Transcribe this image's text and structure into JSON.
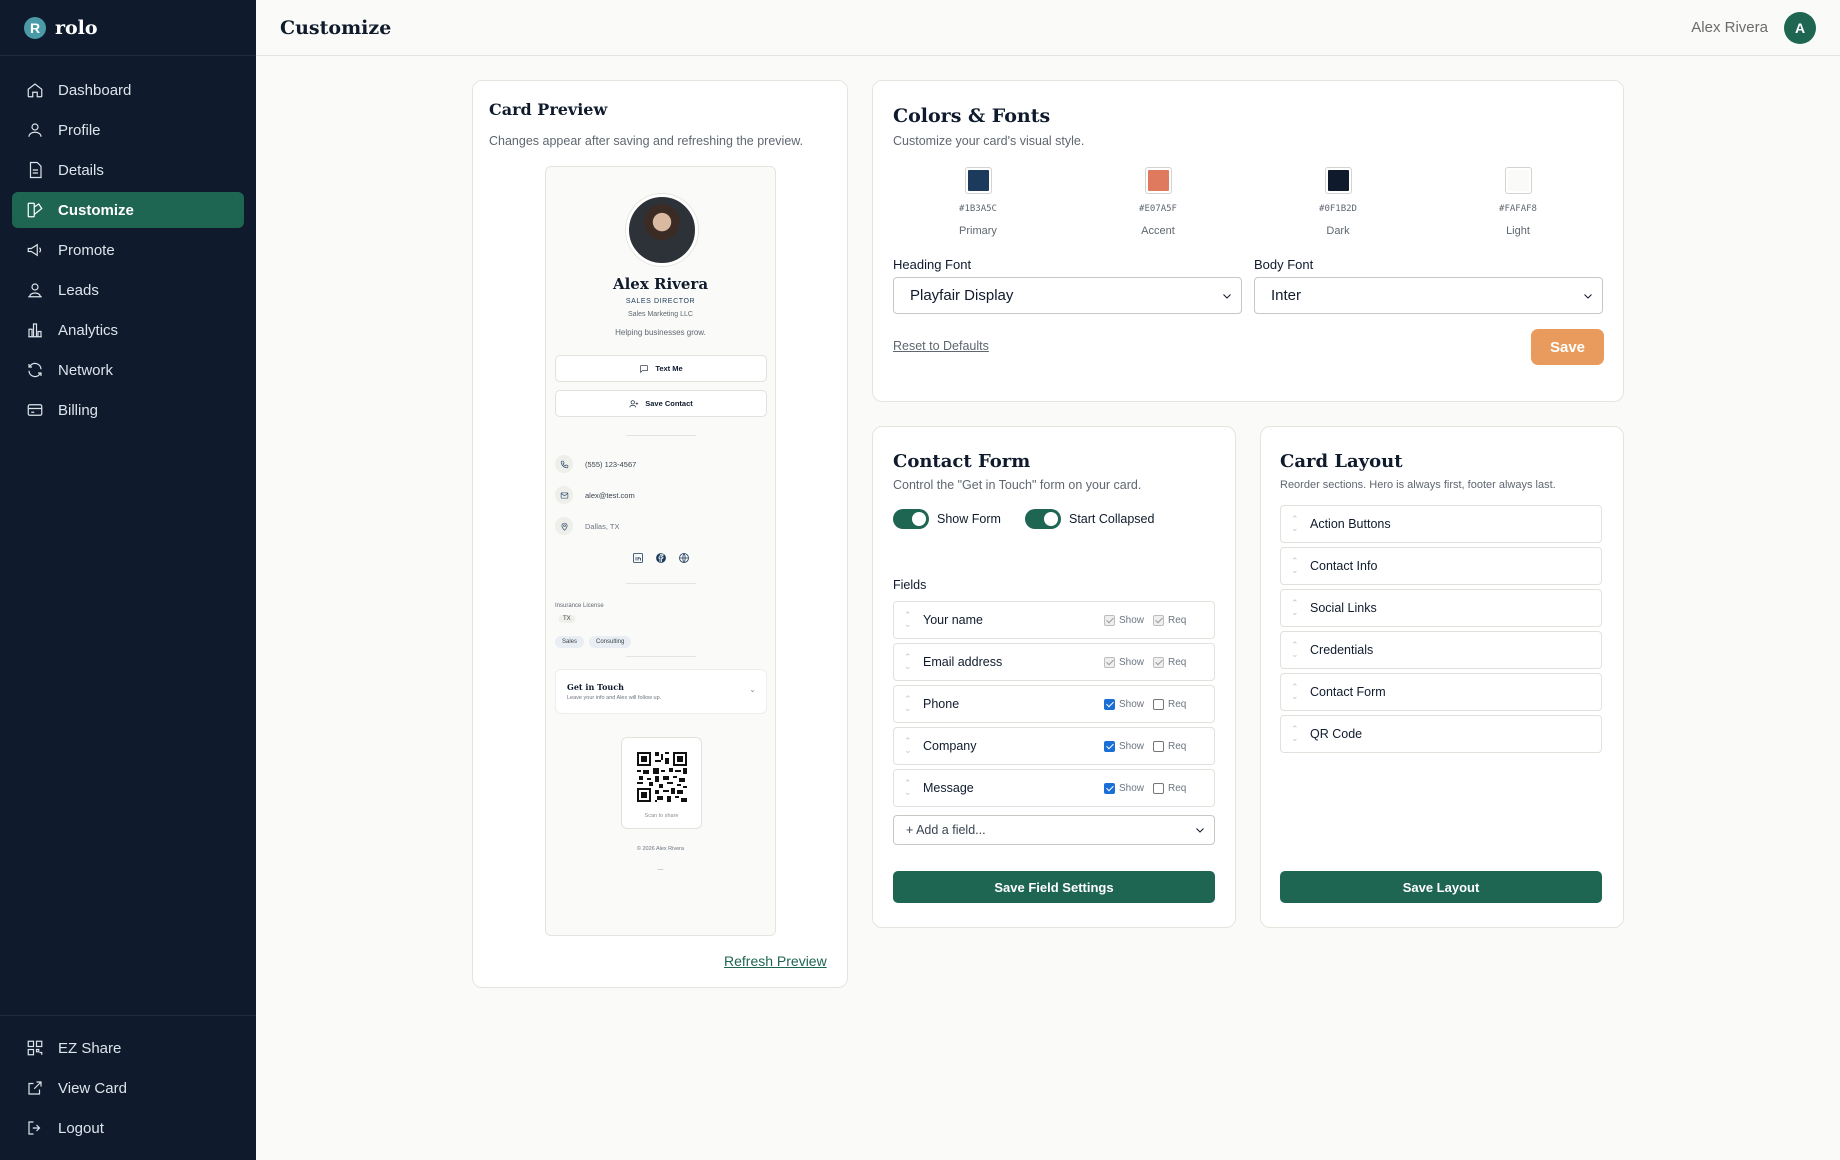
{
  "app": {
    "logo_letter": "R",
    "name": "rolo"
  },
  "sidebar": {
    "items": [
      {
        "label": "Dashboard",
        "icon": "home-icon"
      },
      {
        "label": "Profile",
        "icon": "user-icon"
      },
      {
        "label": "Details",
        "icon": "document-icon"
      },
      {
        "label": "Customize",
        "icon": "palette-icon",
        "active": true
      },
      {
        "label": "Promote",
        "icon": "megaphone-icon"
      },
      {
        "label": "Leads",
        "icon": "leads-icon"
      },
      {
        "label": "Analytics",
        "icon": "bar-chart-icon"
      },
      {
        "label": "Network",
        "icon": "refresh-icon"
      },
      {
        "label": "Billing",
        "icon": "credit-card-icon"
      }
    ],
    "bottom_items": [
      {
        "label": "EZ Share",
        "icon": "qr-code-icon"
      },
      {
        "label": "View Card",
        "icon": "external-link-icon"
      },
      {
        "label": "Logout",
        "icon": "logout-icon"
      }
    ]
  },
  "header": {
    "title": "Customize",
    "user_name": "Alex Rivera",
    "avatar_initial": "A"
  },
  "preview": {
    "title": "Card Preview",
    "subtitle": "Changes appear after saving and refreshing the preview.",
    "card": {
      "name": "Alex Rivera",
      "job_title": "SALES DIRECTOR",
      "company": "Sales Marketing LLC",
      "tagline": "Helping businesses grow.",
      "text_button": "Text Me",
      "save_button": "Save Contact",
      "phone": "(555) 123-4567",
      "email": "alex@test.com",
      "location": "Dallas, TX",
      "credential_label": "Insurance License",
      "credential_value": "TX",
      "tags": [
        "Sales",
        "Consulting"
      ],
      "form_title": "Get in Touch",
      "form_subtitle": "Leave your info and Alex will follow up.",
      "qr_label": "Scan to share",
      "footer": "© 2026 Alex Rivera",
      "footer_mark": "—"
    },
    "refresh_link": "Refresh Preview"
  },
  "colors": {
    "title": "Colors & Fonts",
    "subtitle": "Customize your card's visual style.",
    "swatches": [
      {
        "hex": "#1B3A5C",
        "label": "Primary"
      },
      {
        "hex": "#E07A5F",
        "label": "Accent"
      },
      {
        "hex": "#0F1B2D",
        "label": "Dark"
      },
      {
        "hex": "#FAFAF8",
        "label": "Light"
      }
    ],
    "heading_font_label": "Heading Font",
    "heading_font_value": "Playfair Display",
    "body_font_label": "Body Font",
    "body_font_value": "Inter",
    "reset_link": "Reset to Defaults",
    "save_button": "Save"
  },
  "contact_form": {
    "title": "Contact Form",
    "subtitle": "Control the \"Get in Touch\" form on your card.",
    "show_form_label": "Show Form",
    "show_form_on": true,
    "start_collapsed_label": "Start Collapsed",
    "start_collapsed_on": true,
    "fields_heading": "Fields",
    "show_label": "Show",
    "req_label": "Req",
    "fields": [
      {
        "name": "Your name",
        "show": true,
        "req": true,
        "locked": true
      },
      {
        "name": "Email address",
        "show": true,
        "req": true,
        "locked": true
      },
      {
        "name": "Phone",
        "show": true,
        "req": false,
        "locked": false
      },
      {
        "name": "Company",
        "show": true,
        "req": false,
        "locked": false
      },
      {
        "name": "Message",
        "show": true,
        "req": false,
        "locked": false
      }
    ],
    "add_field_placeholder": "+ Add a field...",
    "save_button": "Save Field Settings"
  },
  "layout": {
    "title": "Card Layout",
    "subtitle": "Reorder sections. Hero is always first, footer always last.",
    "sections": [
      "Action Buttons",
      "Contact Info",
      "Social Links",
      "Credentials",
      "Contact Form",
      "QR Code"
    ],
    "save_button": "Save Layout"
  },
  "theme": {
    "brand": "#1F6652",
    "sidebar_bg": "#0F1B2D",
    "accent_button": "#E89B5C"
  }
}
